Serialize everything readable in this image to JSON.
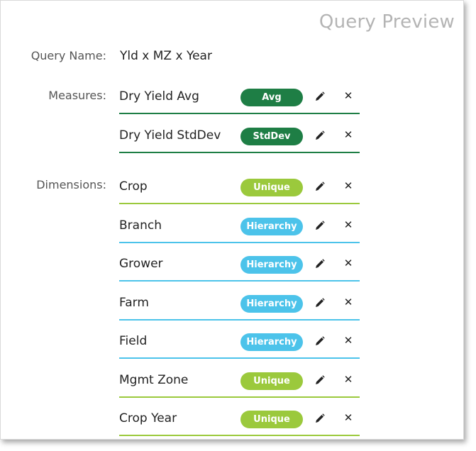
{
  "header": {
    "title": "Query Preview"
  },
  "query": {
    "name_label": "Query Name:",
    "name_value": "Yld x MZ x Year"
  },
  "measures": {
    "label": "Measures:",
    "items": [
      {
        "name": "Dry Yield Avg",
        "badge": "Avg"
      },
      {
        "name": "Dry Yield StdDev",
        "badge": "StdDev"
      }
    ]
  },
  "dimensions": {
    "label": "Dimensions:",
    "items": [
      {
        "name": "Crop",
        "badge": "Unique"
      },
      {
        "name": "Branch",
        "badge": "Hierarchy"
      },
      {
        "name": "Grower",
        "badge": "Hierarchy"
      },
      {
        "name": "Farm",
        "badge": "Hierarchy"
      },
      {
        "name": "Field",
        "badge": "Hierarchy"
      },
      {
        "name": "Mgmt Zone",
        "badge": "Unique"
      },
      {
        "name": "Crop Year",
        "badge": "Unique"
      }
    ]
  },
  "icons": {
    "edit": "pencil-icon",
    "delete": "close-icon"
  },
  "colors": {
    "measure": "#1e7e45",
    "unique": "#9bc93c",
    "hierarchy": "#4cc3ea",
    "title": "#b4b4b4"
  }
}
